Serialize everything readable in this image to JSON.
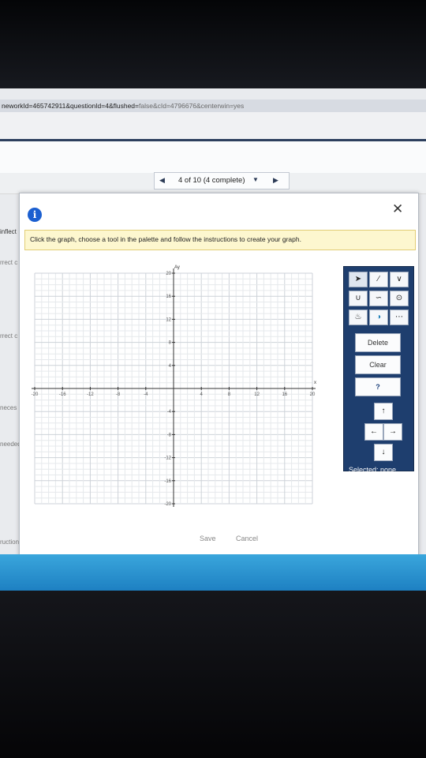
{
  "browser": {
    "url_prefix": "neworkId=465742911&questionId=4&flushed=",
    "url_suffix": "false&cId=4796676&centerwin=yes"
  },
  "pager": {
    "prev_icon": "◀",
    "label": "4 of 10 (4 complete)",
    "dropdown_icon": "▼",
    "next_icon": "▶"
  },
  "background_fragments": {
    "f1": "inflect",
    "f2": "rrect c",
    "f3": "rrect c",
    "f4": "neces",
    "f5": "needed",
    "f6": "ructions"
  },
  "dialog": {
    "info_icon": "i",
    "close_icon": "✕",
    "instruction": "Click the graph, choose a tool in the palette and follow the instructions to create your graph."
  },
  "graph": {
    "x_axis_label": "x",
    "y_axis_label": "Ay",
    "x_ticks": [
      "-20",
      "-16",
      "-12",
      "-8",
      "-4",
      "4",
      "8",
      "12",
      "16",
      "20"
    ],
    "y_ticks": [
      "20",
      "16",
      "12",
      "8",
      "4",
      "-4",
      "-8",
      "-12",
      "-16",
      "-20"
    ]
  },
  "palette": {
    "tools_row1": [
      "pointer",
      "line-segment",
      "v-shape"
    ],
    "tools_row2": [
      "parabola",
      "curve",
      "circle"
    ],
    "tools_row3": [
      "paint-bucket",
      "region",
      "dashed-line"
    ],
    "delete_label": "Delete",
    "clear_label": "Clear",
    "help_label": "?",
    "up_arrow": "↑",
    "left_arrow": "←",
    "right_arrow": "→",
    "down_arrow": "↓",
    "selected_label": "Selected: none"
  },
  "footer": {
    "save_label": "Save",
    "cancel_label": "Cancel"
  },
  "colors": {
    "palette_bg": "#1e3e6e",
    "instruction_bg": "#fdf7cf",
    "info_blue": "#1b5fd0"
  }
}
